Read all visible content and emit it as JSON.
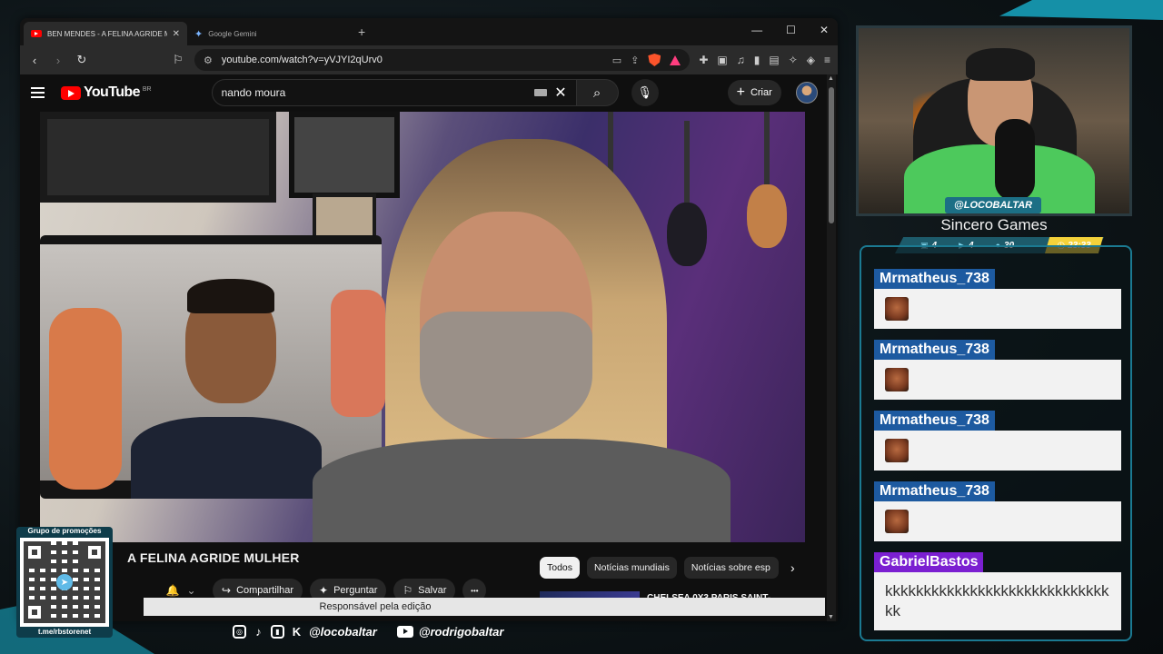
{
  "browser": {
    "tabs": [
      {
        "title": "BEN MENDES - A FELINA AGRIDE MULH",
        "active": true,
        "close": "✕"
      },
      {
        "title": "Google Gemini",
        "active": false
      }
    ],
    "new_tab": "+",
    "window_controls": {
      "minimize": "—",
      "maximize": "☐",
      "close": "✕"
    },
    "url": "youtube.com/watch?v=yVJYI2qUrv0",
    "brave_badge": "99+"
  },
  "youtube": {
    "logo_text": "YouTube",
    "region": "BR",
    "search_query": "nando moura",
    "create_label": "Criar",
    "video_title": "A FELINA AGRIDE MULHER",
    "actions": {
      "share": "Compartilhar",
      "ask": "Perguntar",
      "save": "Salvar",
      "more": "•••"
    },
    "chips": [
      "Todos",
      "Notícias mundiais",
      "Notícias sobre esp"
    ],
    "rec_title": "CHELSEA 0X3 PARIS SAINT-",
    "tooltip": "Responsável pela edição"
  },
  "overlay": {
    "handle_tag": "@LOCOBALTAR",
    "channel_name": "Sincero Games",
    "stats": {
      "chat": "4",
      "video": "4",
      "viewers": "30"
    },
    "timer": "23:33"
  },
  "chat": {
    "messages": [
      {
        "user": "Mrmatheus_738",
        "text": "",
        "emote": true
      },
      {
        "user": "Mrmatheus_738",
        "text": "",
        "emote": true
      },
      {
        "user": "Mrmatheus_738",
        "text": "",
        "emote": true
      },
      {
        "user": "Mrmatheus_738",
        "text": "",
        "emote": true
      },
      {
        "user": "GabrielBastos",
        "text": "kkkkkkkkkkkkkkkkkkkkkkkkkkkkkkk",
        "emote": false
      }
    ]
  },
  "promo": {
    "title": "Grupo de promoções",
    "url": "t.me/rbstorenet"
  },
  "socials": {
    "handle1": "@locobaltar",
    "handle2": "@rodrigobaltar"
  },
  "colors": {
    "accent": "#1b7a92",
    "chat_name_bg": "#1d5aa0",
    "chat_name_purple": "#7b1fd1",
    "timer_yellow": "#f4d23a",
    "yt_red": "#ff0000"
  }
}
